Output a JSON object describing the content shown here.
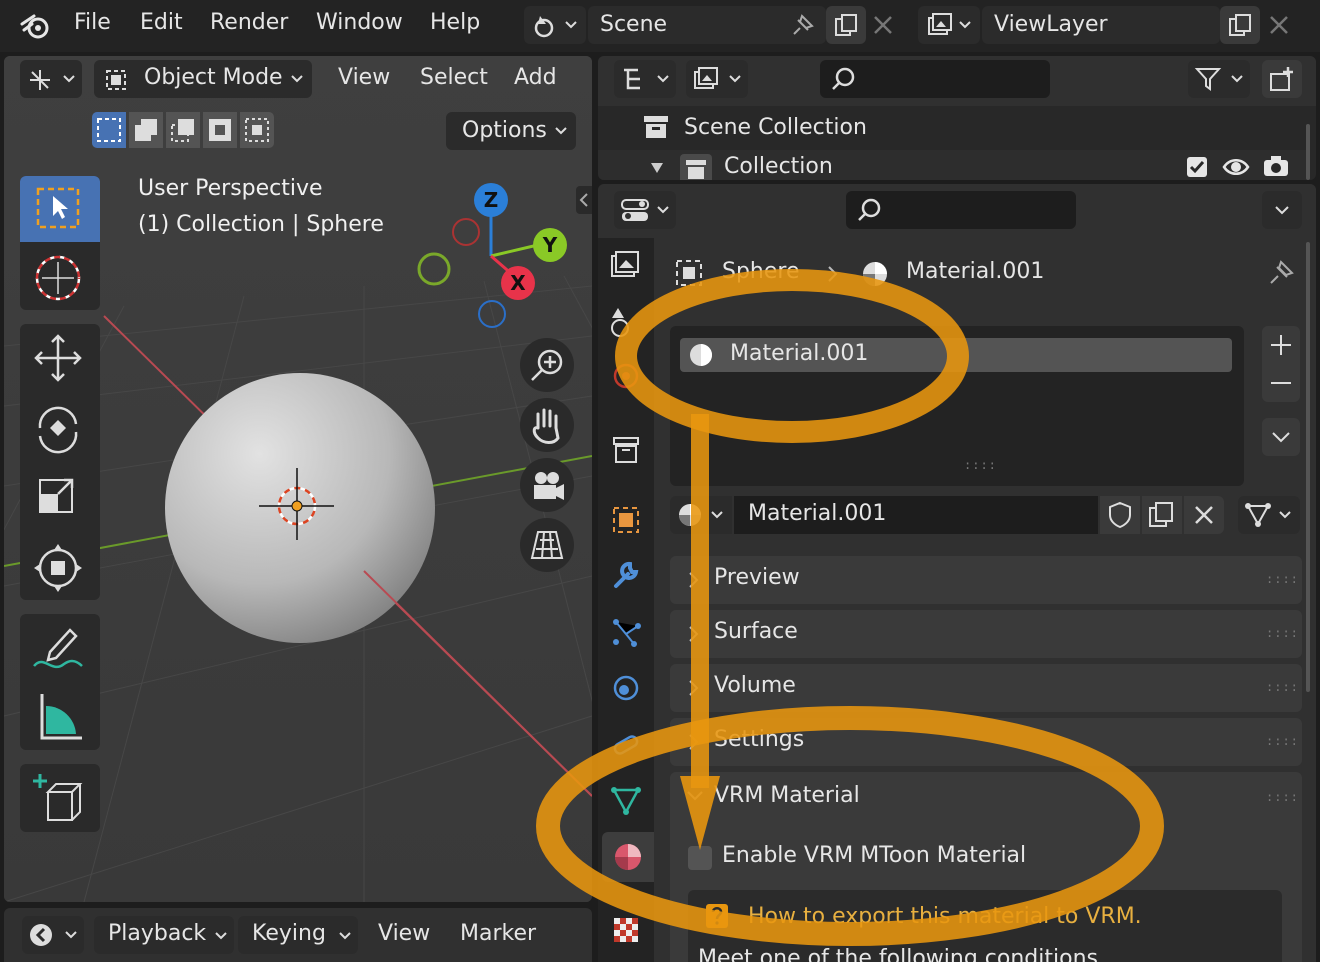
{
  "topbar": {
    "menu": [
      "File",
      "Edit",
      "Render",
      "Window",
      "Help"
    ],
    "scene_label": "Scene",
    "viewlayer_label": "ViewLayer"
  },
  "viewport": {
    "mode_label": "Object Mode",
    "menu": [
      "View",
      "Select",
      "Add"
    ],
    "options_label": "Options",
    "overlay_line1": "User Perspective",
    "overlay_line2": "(1) Collection | Sphere",
    "gizmo": {
      "z": "Z",
      "y": "Y",
      "x": "X"
    }
  },
  "timeline": {
    "playback_label": "Playback",
    "keying_label": "Keying",
    "view_label": "View",
    "marker_label": "Marker"
  },
  "outliner": {
    "scene_collection": "Scene Collection",
    "collection": "Collection"
  },
  "properties": {
    "breadcrumb_object": "Sphere",
    "breadcrumb_material": "Material.001",
    "slot_item": "Material.001",
    "material_name": "Material.001",
    "grip": "::::",
    "panels": [
      "Preview",
      "Surface",
      "Volume",
      "Settings"
    ],
    "vrm_panel": "VRM Material",
    "enable_label": "Enable VRM MToon Material",
    "help_title": "How to export this material to VRM.",
    "help_body": "Meet one of the following conditions."
  },
  "colors": {
    "annotation": "#e8960f",
    "accent_blue": "#4772b3",
    "axis_x": "#e8334a",
    "axis_y": "#8ac926",
    "axis_z": "#2b7fd8"
  }
}
